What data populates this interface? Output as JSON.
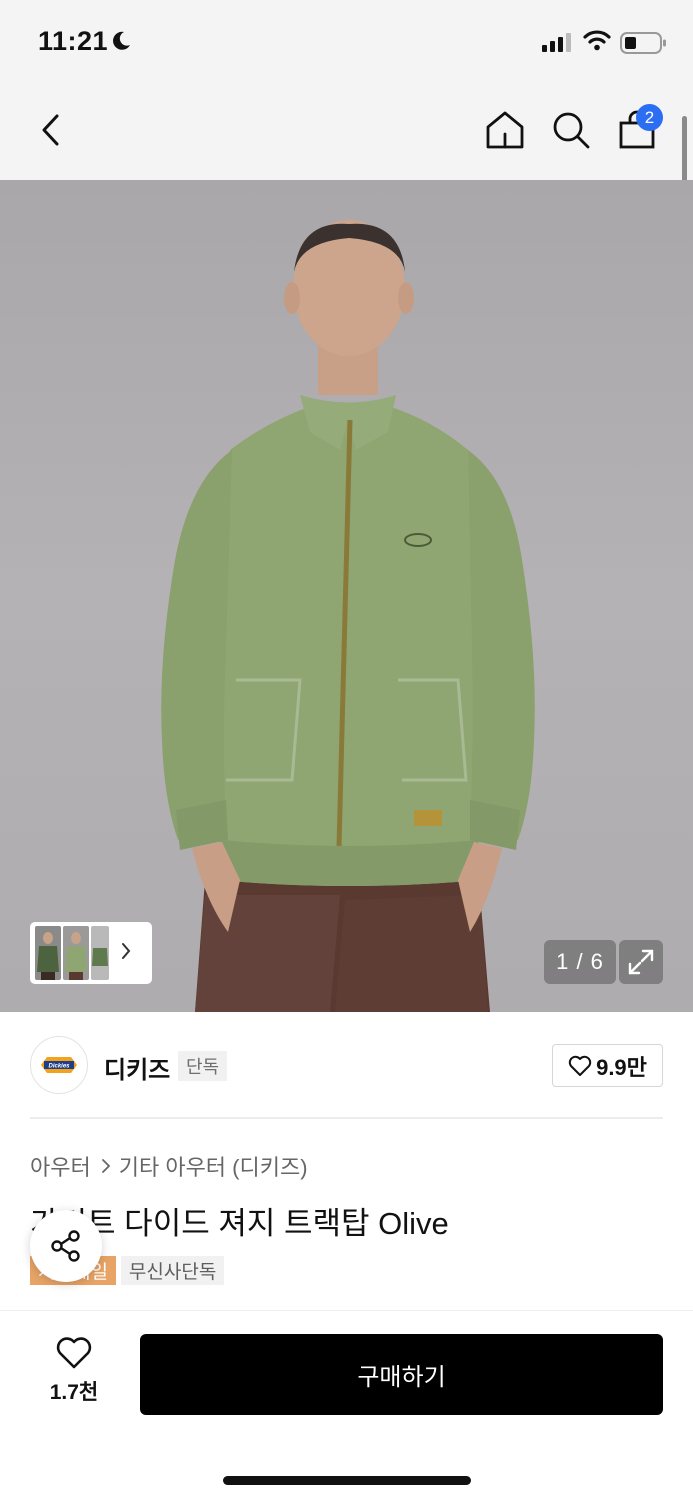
{
  "status_bar": {
    "time": "11:21",
    "icons": [
      "moon-icon",
      "signal-icon",
      "wifi-icon",
      "battery-icon"
    ]
  },
  "nav": {
    "icons": [
      "back-icon",
      "home-icon",
      "search-icon",
      "cart-icon"
    ],
    "cart_badge": "2"
  },
  "gallery": {
    "counter": "1 / 6",
    "current_index": 1,
    "total": 6,
    "expand_icon": "expand-icon"
  },
  "brand": {
    "name": "디키즈",
    "exclusive_label": "단독",
    "logo_text": "Dickies",
    "like_count": "9.9만"
  },
  "product": {
    "breadcrumb": [
      "아우터",
      "기타 아우터 (디키즈)"
    ],
    "title": "가먼트 다이드 져지 트랙탑 Olive",
    "tags": [
      "시즌세일",
      "무신사단독"
    ]
  },
  "bottom_bar": {
    "like_count": "1.7천",
    "buy_label": "구매하기"
  },
  "colors": {
    "accent_blue": "#2b6ef3",
    "sale_tag": "#e8a466",
    "buy_button": "#000000"
  }
}
